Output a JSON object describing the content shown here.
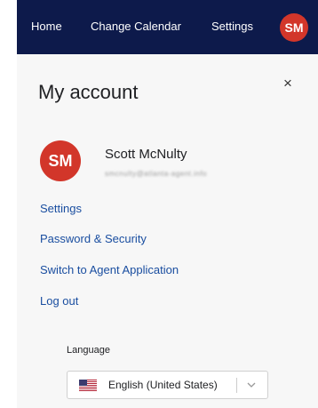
{
  "nav": {
    "home": "Home",
    "change_calendar": "Change Calendar",
    "settings": "Settings",
    "avatar_initials": "SM"
  },
  "panel": {
    "title": "My account",
    "close": "×"
  },
  "profile": {
    "initials": "SM",
    "name": "Scott McNulty",
    "email": "smcnulty@atlanta-agent.info"
  },
  "links": {
    "settings": "Settings",
    "password_security": "Password & Security",
    "switch_agent": "Switch to Agent Application",
    "log_out": "Log out"
  },
  "language": {
    "label": "Language",
    "selected": "English (United States)",
    "flag_icon": "us-flag-icon"
  },
  "colors": {
    "navbar": "#0d1a4b",
    "avatar": "#d2362a",
    "link": "#1a4ea0",
    "panel_bg": "#f7f7f7"
  }
}
